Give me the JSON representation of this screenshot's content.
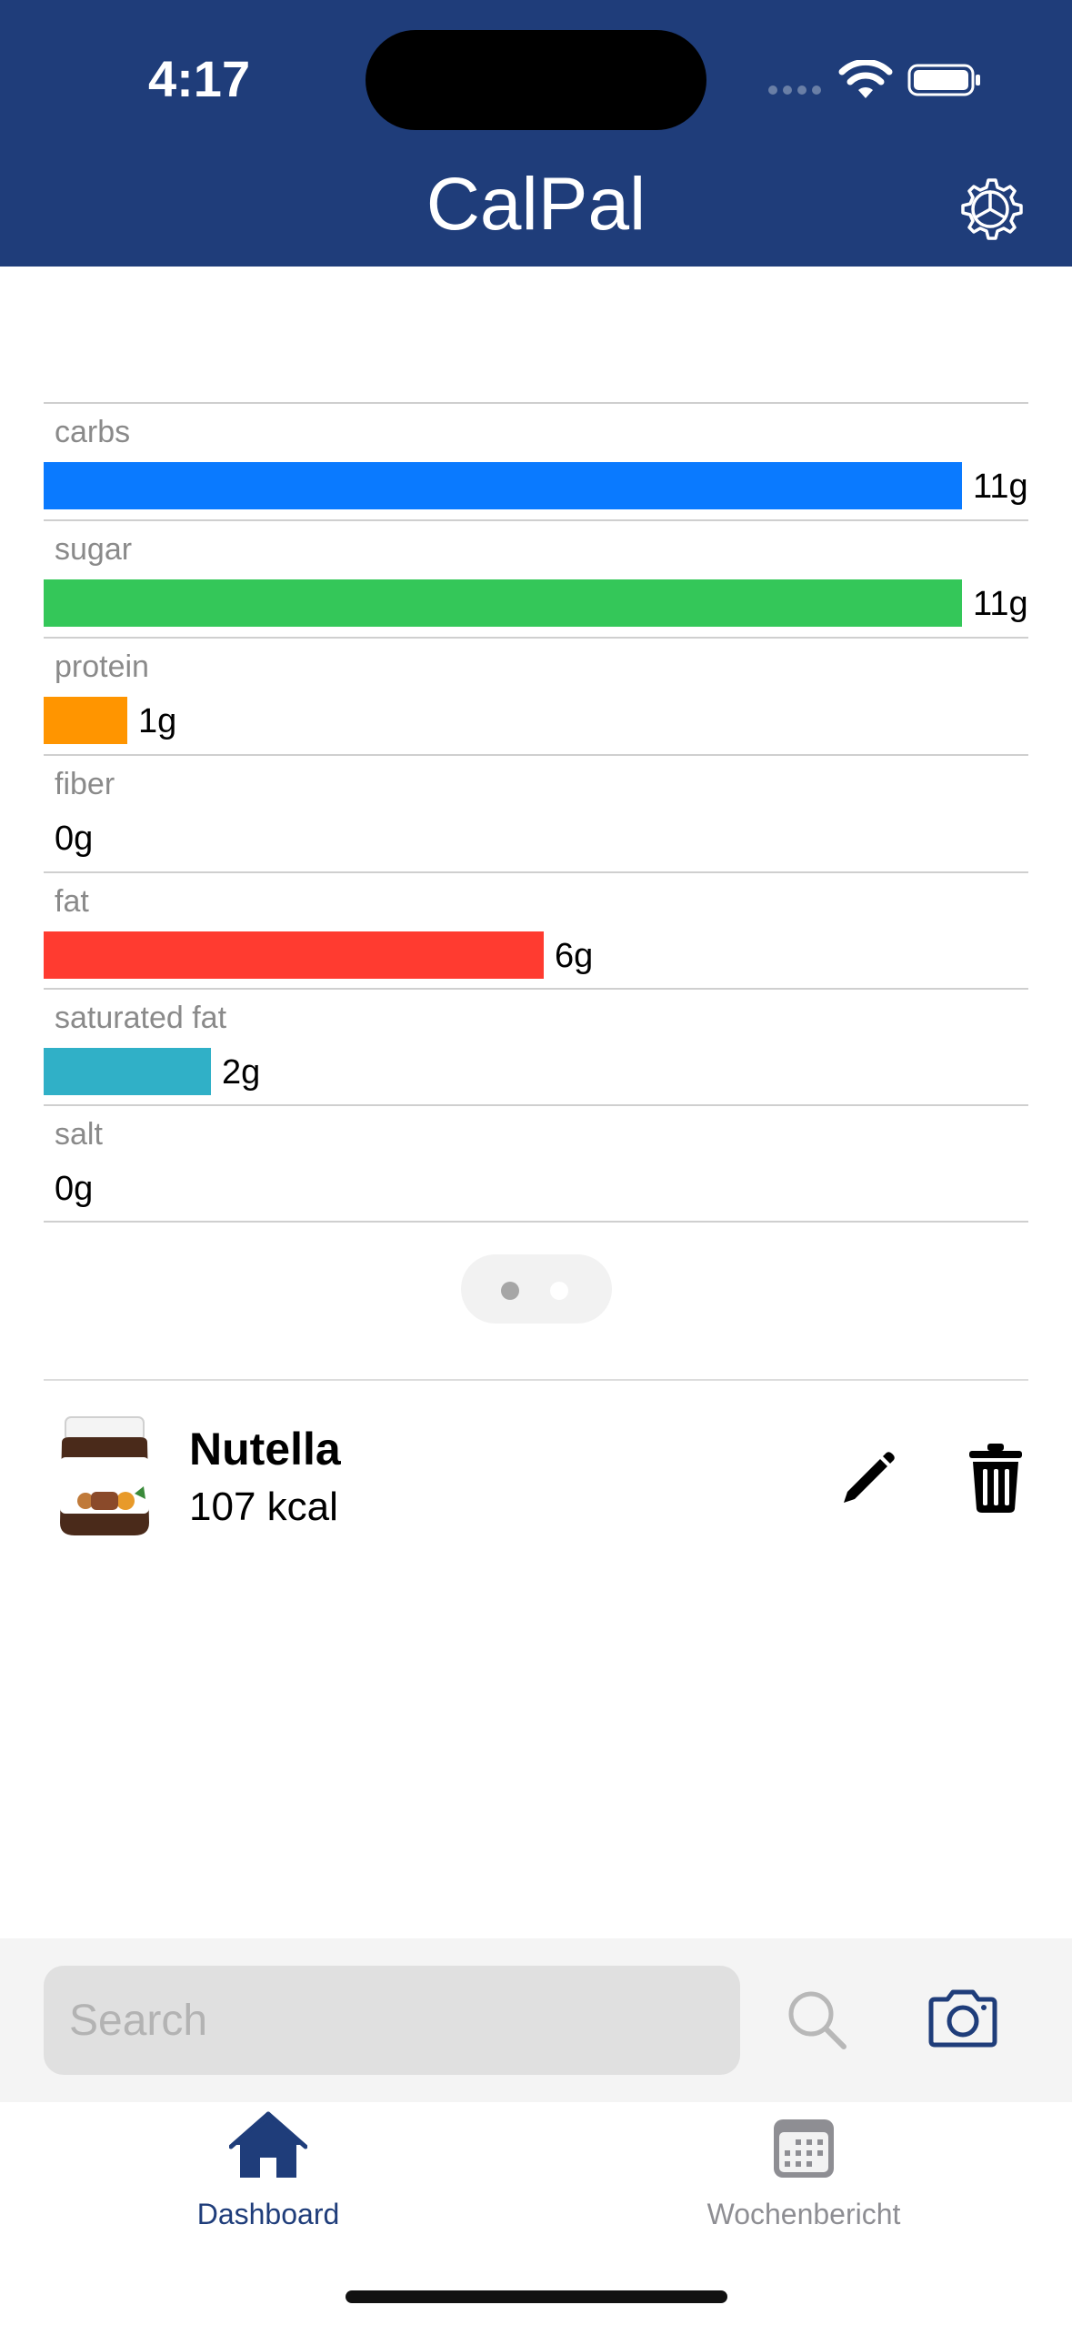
{
  "status_bar": {
    "time": "4:17"
  },
  "header": {
    "title": "CalPal"
  },
  "nutrients": [
    {
      "label": "carbs",
      "value_text": "11g",
      "fill": 1.0,
      "color": "#0a7aff"
    },
    {
      "label": "sugar",
      "value_text": "11g",
      "fill": 1.0,
      "color": "#34c759"
    },
    {
      "label": "protein",
      "value_text": "1g",
      "fill": 0.091,
      "color": "#ff9500"
    },
    {
      "label": "fiber",
      "value_text": "0g",
      "fill": 0,
      "color": "#8e8e93"
    },
    {
      "label": "fat",
      "value_text": "6g",
      "fill": 0.545,
      "color": "#ff3b30"
    },
    {
      "label": "saturated fat",
      "value_text": "2g",
      "fill": 0.182,
      "color": "#30b0c7"
    },
    {
      "label": "salt",
      "value_text": "0g",
      "fill": 0,
      "color": "#8e8e93"
    }
  ],
  "pager": {
    "pages": 2,
    "current": 1
  },
  "food_entries": [
    {
      "name": "Nutella",
      "kcal_text": "107 kcal",
      "image_icon": "nutella-jar-icon",
      "edit_icon": "pencil-icon",
      "delete_icon": "trash-icon"
    }
  ],
  "search": {
    "placeholder": "Search",
    "value": "",
    "search_icon": "magnifier-icon",
    "camera_icon": "camera-icon"
  },
  "tabs": [
    {
      "label": "Dashboard",
      "icon": "house-icon",
      "active": true
    },
    {
      "label": "Wochenbericht",
      "icon": "calendar-icon",
      "active": false
    }
  ],
  "colors": {
    "header_bg": "#1f3d7a",
    "accent": "#1f3d7a",
    "inactive": "#8e8e93"
  }
}
